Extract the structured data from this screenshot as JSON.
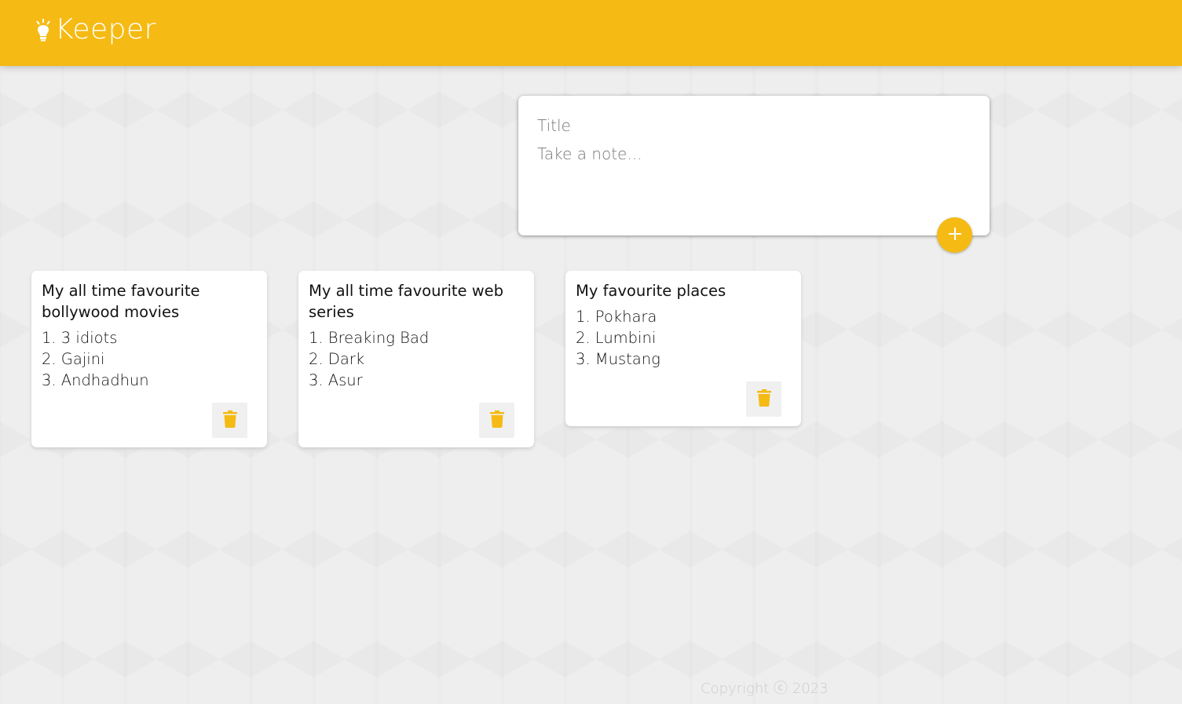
{
  "app": {
    "title": "Keeper",
    "accent_color": "#f5ba13",
    "logo_icon": "lightbulb-icon"
  },
  "create_note": {
    "title_placeholder": "Title",
    "content_placeholder": "Take a note...",
    "add_icon": "plus-icon"
  },
  "notes": [
    {
      "title": "My all time favourite bollywood movies",
      "content": "1. 3 idiots\n2. Gajini\n3. Andhadhun",
      "delete_icon": "trash-icon"
    },
    {
      "title": "My all time favourite web series",
      "content": "1. Breaking Bad\n2. Dark\n3. Asur",
      "delete_icon": "trash-icon"
    },
    {
      "title": "My favourite places",
      "content": "1. Pokhara\n2. Lumbini\n3. Mustang",
      "delete_icon": "trash-icon"
    }
  ],
  "footer": {
    "copyright": "Copyright ⓒ 2023"
  }
}
